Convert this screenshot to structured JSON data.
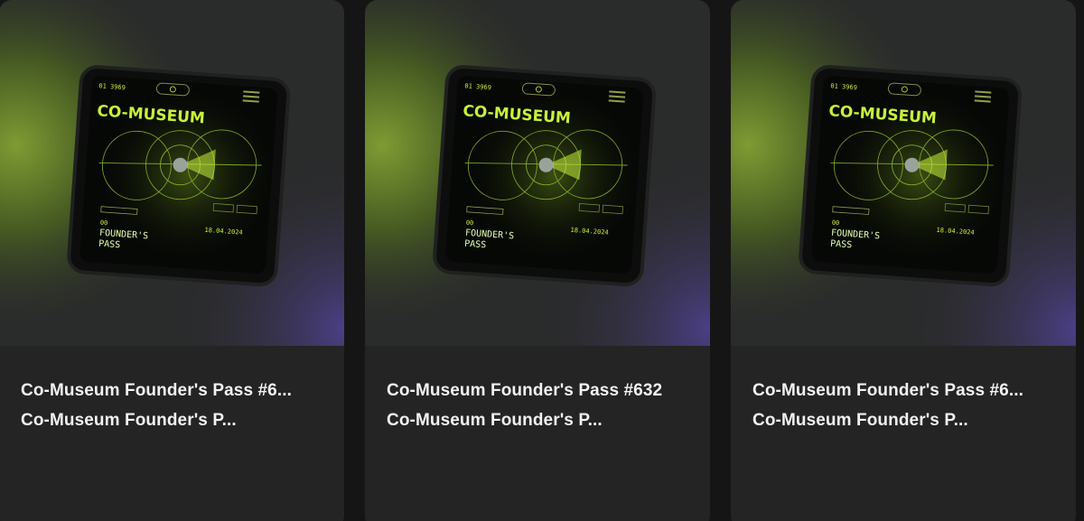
{
  "cards": [
    {
      "title": "Co-Museum Founder's Pass #6...",
      "subtitle": "Co-Museum Founder's P...",
      "art": {
        "brand": "CO-MUSEUM",
        "counter_prefix": "01",
        "counter": "3969",
        "pass_label_line1": "FOUNDER'S",
        "pass_label_line2": "PASS",
        "pass_number": "00",
        "date": "18.04.2024"
      }
    },
    {
      "title": "Co-Museum Founder's Pass #632",
      "subtitle": "Co-Museum Founder's P...",
      "art": {
        "brand": "CO-MUSEUM",
        "counter_prefix": "01",
        "counter": "3969",
        "pass_label_line1": "FOUNDER'S",
        "pass_label_line2": "PASS",
        "pass_number": "00",
        "date": "18.04.2024"
      }
    },
    {
      "title": "Co-Museum Founder's Pass #6...",
      "subtitle": "Co-Museum Founder's P...",
      "art": {
        "brand": "CO-MUSEUM",
        "counter_prefix": "01",
        "counter": "3969",
        "pass_label_line1": "FOUNDER'S",
        "pass_label_line2": "PASS",
        "pass_number": "00",
        "date": "18.04.2024"
      }
    }
  ],
  "colors": {
    "page_background": "#151515",
    "card_background": "#242424",
    "title_text": "#f2f2f2",
    "neon_green": "#c8f03c",
    "olive_glow": "#6f8a2c",
    "purple_glow": "#4b3f86"
  }
}
